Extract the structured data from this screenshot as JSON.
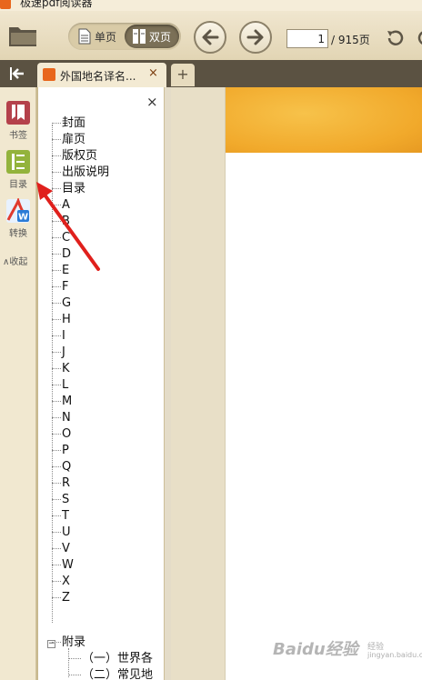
{
  "app": {
    "title": "极速pdf阅读器"
  },
  "toolbar": {
    "open_icon": "folder-icon",
    "single_page_label": "单页",
    "double_page_label": "双页",
    "current_page": "1",
    "total_pages_label": "/ 915页"
  },
  "tabs": [
    {
      "title": "外国地名译名...",
      "close": "×"
    }
  ],
  "add_tab_label": "+",
  "rail": {
    "bookmarks_label": "书签",
    "toc_label": "目录",
    "convert_label": "转换",
    "collapse_label": "∧收起"
  },
  "toc": {
    "close": "×",
    "items": [
      "封面",
      "扉页",
      "版权页",
      "出版说明",
      "目录",
      "A",
      "B",
      "C",
      "D",
      "E",
      "F",
      "G",
      "H",
      "I",
      "J",
      "K",
      "L",
      "M",
      "N",
      "O",
      "P",
      "Q",
      "R",
      "S",
      "T",
      "U",
      "V",
      "W",
      "X",
      "Z"
    ],
    "appendix_label": "附录",
    "appendix_expander": "−",
    "appendix_items": [
      "（一）世界各",
      "（二）常见地"
    ]
  },
  "watermark": {
    "text": "Baidu经验",
    "sub": "经验",
    "url": "jingyan.baidu.com"
  },
  "colors": {
    "accent": "#e8661c",
    "toolbar": "#e2d5b4",
    "tabbar": "#5b5242",
    "arrow": "#e0201c"
  }
}
